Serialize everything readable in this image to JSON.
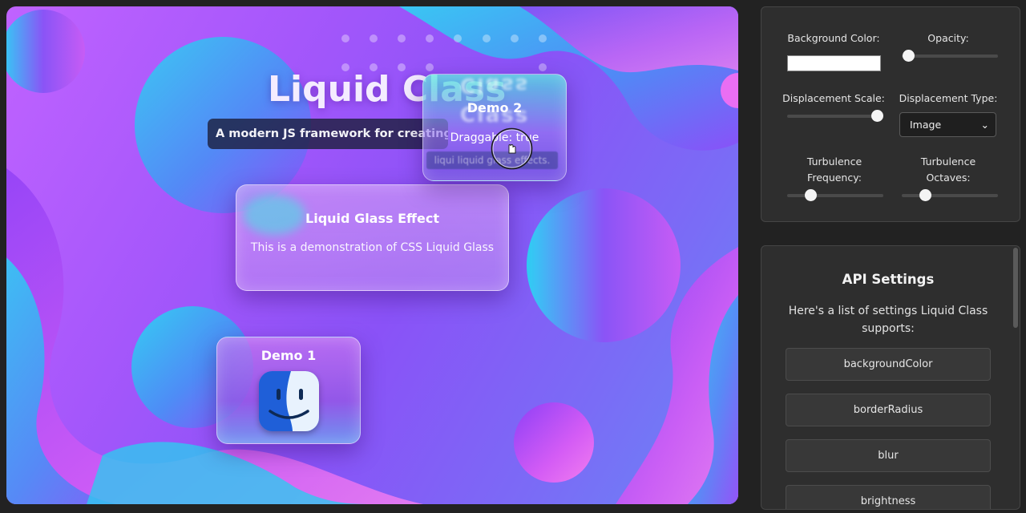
{
  "hero": {
    "title": "Liquid Class",
    "subtitle": "A modern JS framework for creating l"
  },
  "demo2": {
    "title": "Demo 2",
    "draggable": "Draggable: true",
    "ghost_text": "Class",
    "strip_text": "liqui liquid glass effects."
  },
  "effect_card": {
    "title": "Liquid Glass Effect",
    "body": "This is a demonstration of CSS Liquid Glass"
  },
  "demo1": {
    "title": "Demo 1",
    "icon": "finder-icon"
  },
  "controls": {
    "background_color_label": "Background Color:",
    "background_color_value": "#ffffff",
    "opacity_label": "Opacity:",
    "opacity_value": 0.0,
    "displacement_scale_label": "Displacement Scale:",
    "displacement_scale_value": 1.0,
    "displacement_type_label": "Displacement Type:",
    "displacement_type_value": "Image",
    "turbulence_frequency_label": "Turbulence Frequency:",
    "turbulence_frequency_value": 0.2,
    "turbulence_octaves_label": "Turbulence Octaves:",
    "turbulence_octaves_value": 0.2
  },
  "api": {
    "heading": "API Settings",
    "description": "Here's a list of settings Liquid Class supports:",
    "items": [
      "backgroundColor",
      "borderRadius",
      "blur",
      "brightness"
    ]
  },
  "colors": {
    "page_bg": "#222222",
    "panel_bg": "#2e2e2e",
    "accent_purple": "#8a52f7",
    "accent_cyan": "#29c7ee"
  }
}
